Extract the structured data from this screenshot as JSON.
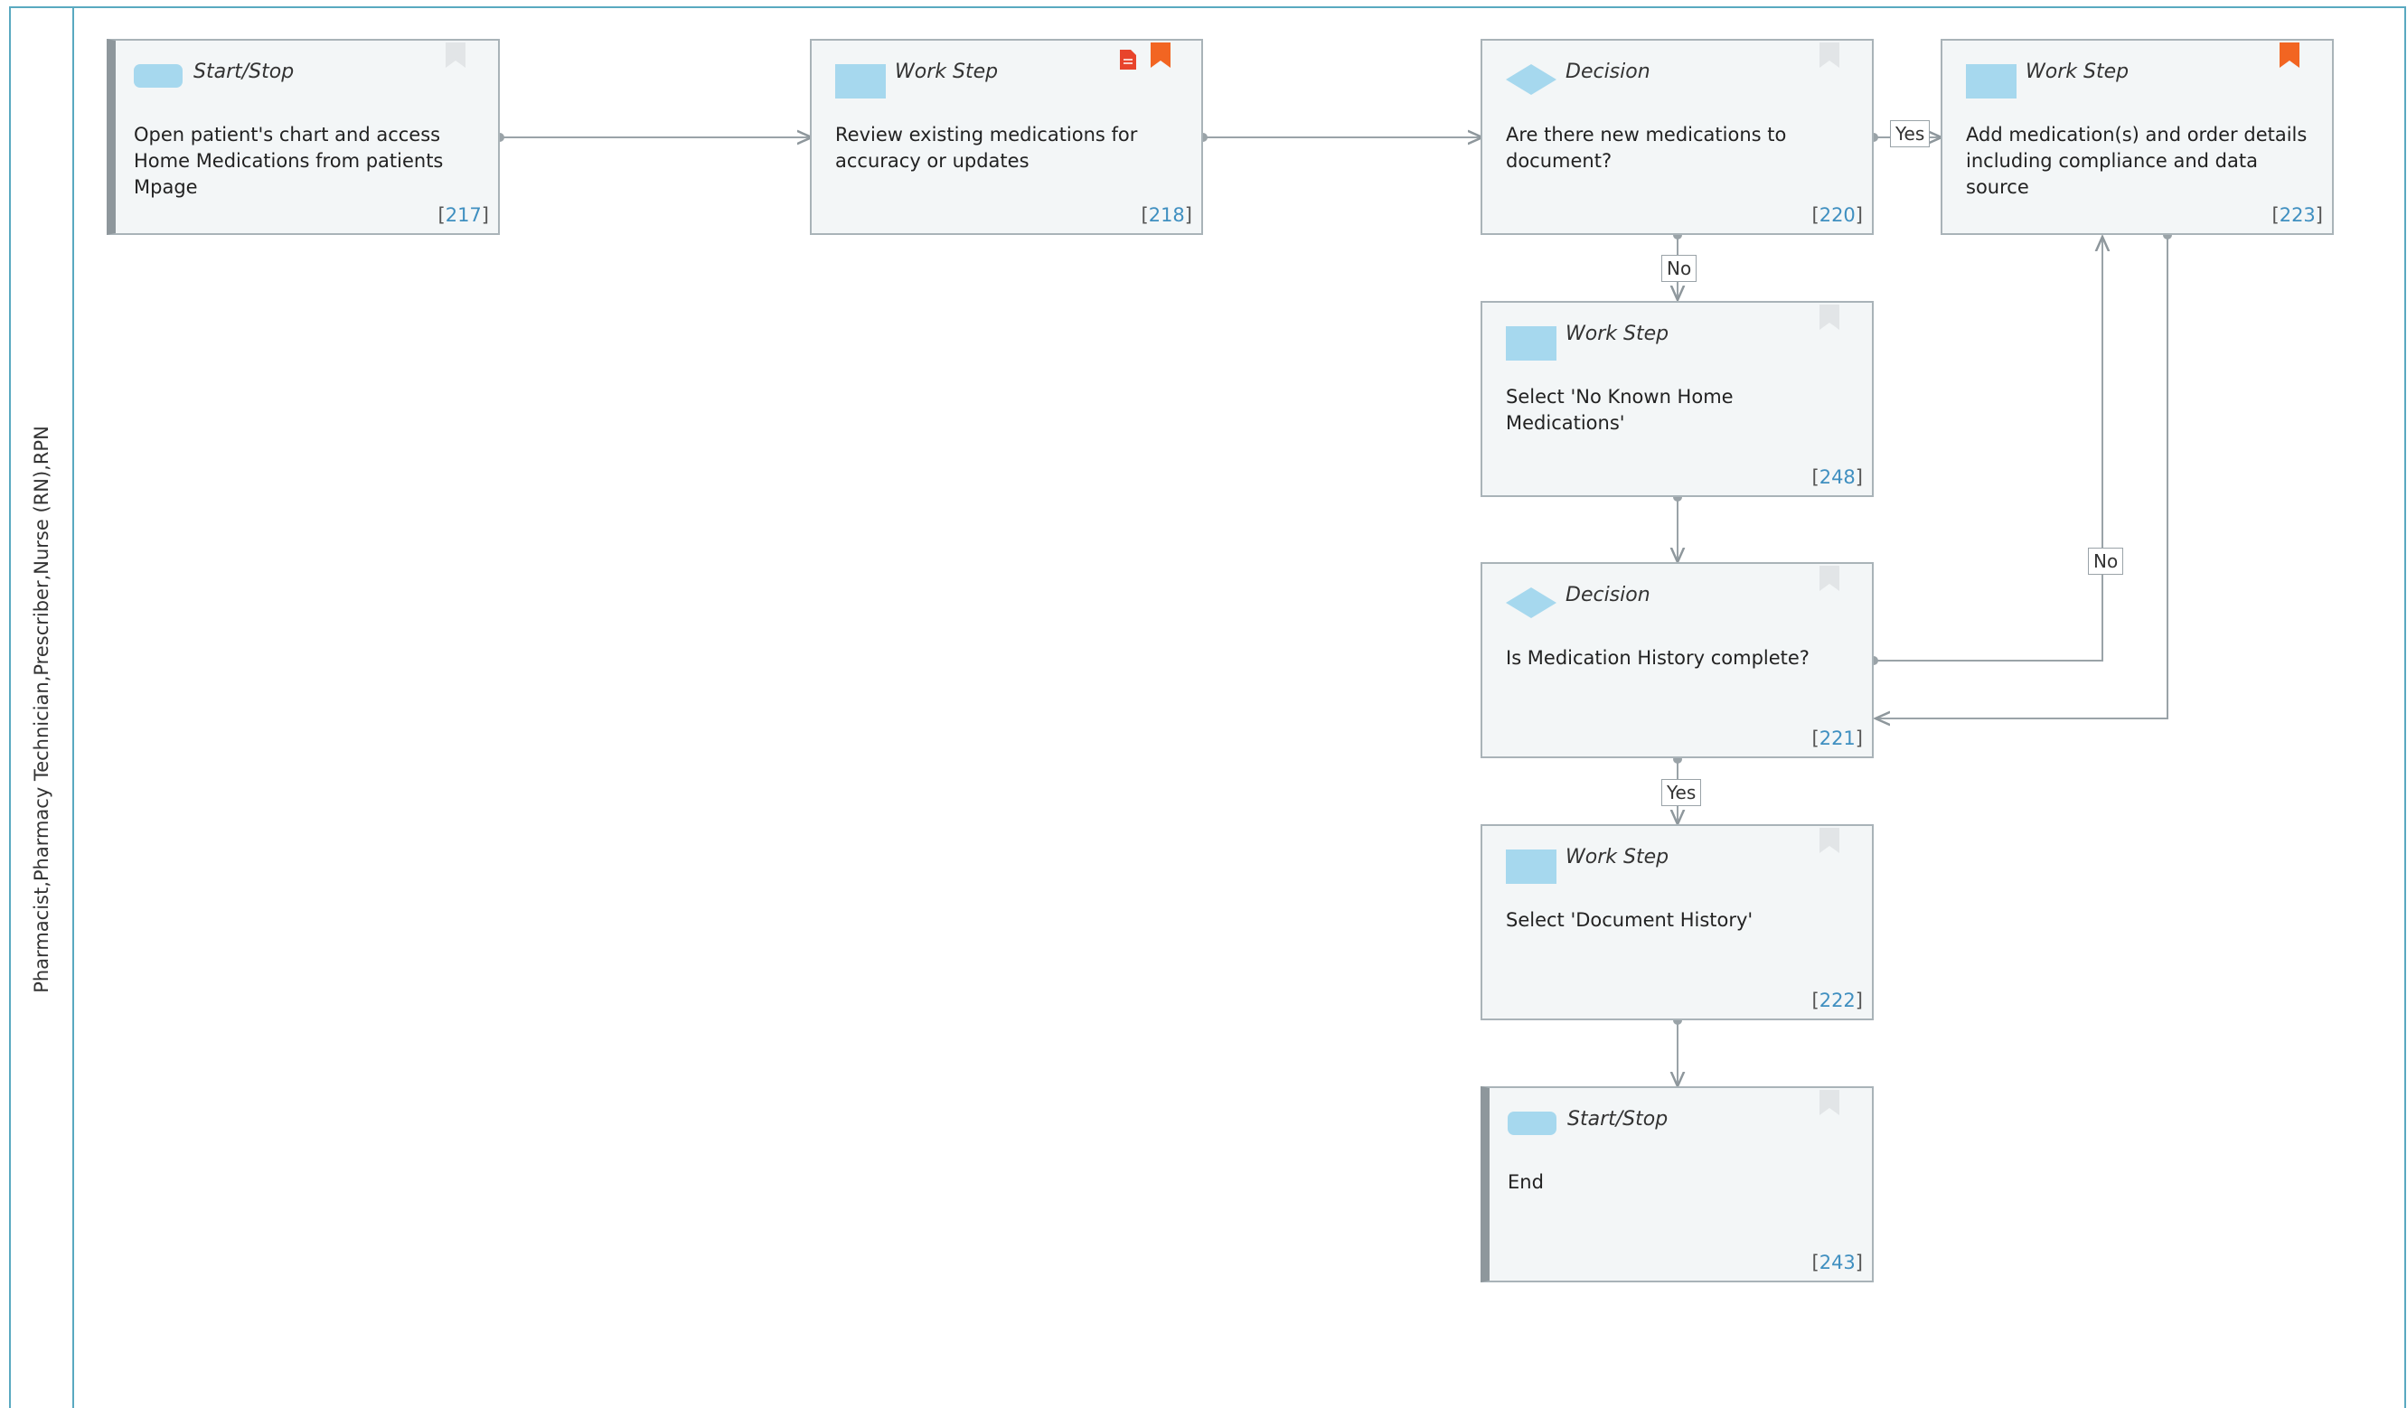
{
  "lane": {
    "label": "Pharmacist,Pharmacy Technician,Prescriber,Nurse (RN),RPN"
  },
  "colors": {
    "lane_border": "#5aa9c0",
    "node_fill": "#f3f6f7",
    "shape_fill": "#a6d8ee",
    "bookmark_active": "#f26522",
    "bookmark_inactive": "#e2e5e7",
    "ref_number": "#3f8fc0"
  },
  "nodes": [
    {
      "id": "n217",
      "type": "Start/Stop",
      "text": "Open patient's chart and access Home Medications from patients Mpage",
      "ref": "217",
      "bookmark": "inactive",
      "doc": false
    },
    {
      "id": "n218",
      "type": "Work Step",
      "text": "Review existing medications for accuracy or updates",
      "ref": "218",
      "bookmark": "active",
      "doc": true
    },
    {
      "id": "n220",
      "type": "Decision",
      "text": "Are there new medications to document?",
      "ref": "220",
      "bookmark": "inactive",
      "doc": false
    },
    {
      "id": "n223",
      "type": "Work Step",
      "text": "Add medication(s) and order details including compliance and data source",
      "ref": "223",
      "bookmark": "active",
      "doc": false
    },
    {
      "id": "n248",
      "type": "Work Step",
      "text": "Select 'No Known Home Medications'",
      "ref": "248",
      "bookmark": "inactive",
      "doc": false
    },
    {
      "id": "n221",
      "type": "Decision",
      "text": "Is Medication History complete?",
      "ref": "221",
      "bookmark": "inactive",
      "doc": false
    },
    {
      "id": "n222",
      "type": "Work Step",
      "text": "Select 'Document History'",
      "ref": "222",
      "bookmark": "inactive",
      "doc": false
    },
    {
      "id": "n243",
      "type": "Start/Stop",
      "text": "End",
      "ref": "243",
      "bookmark": "inactive",
      "doc": false
    }
  ],
  "edges": [
    {
      "from": "217",
      "to": "218",
      "label": ""
    },
    {
      "from": "218",
      "to": "220",
      "label": ""
    },
    {
      "from": "220",
      "to": "223",
      "label": "Yes"
    },
    {
      "from": "220",
      "to": "248",
      "label": "No"
    },
    {
      "from": "248",
      "to": "221",
      "label": ""
    },
    {
      "from": "221",
      "to": "223",
      "label": "No"
    },
    {
      "from": "223",
      "to": "221",
      "label": ""
    },
    {
      "from": "221",
      "to": "222",
      "label": "Yes"
    },
    {
      "from": "222",
      "to": "243",
      "label": ""
    }
  ]
}
